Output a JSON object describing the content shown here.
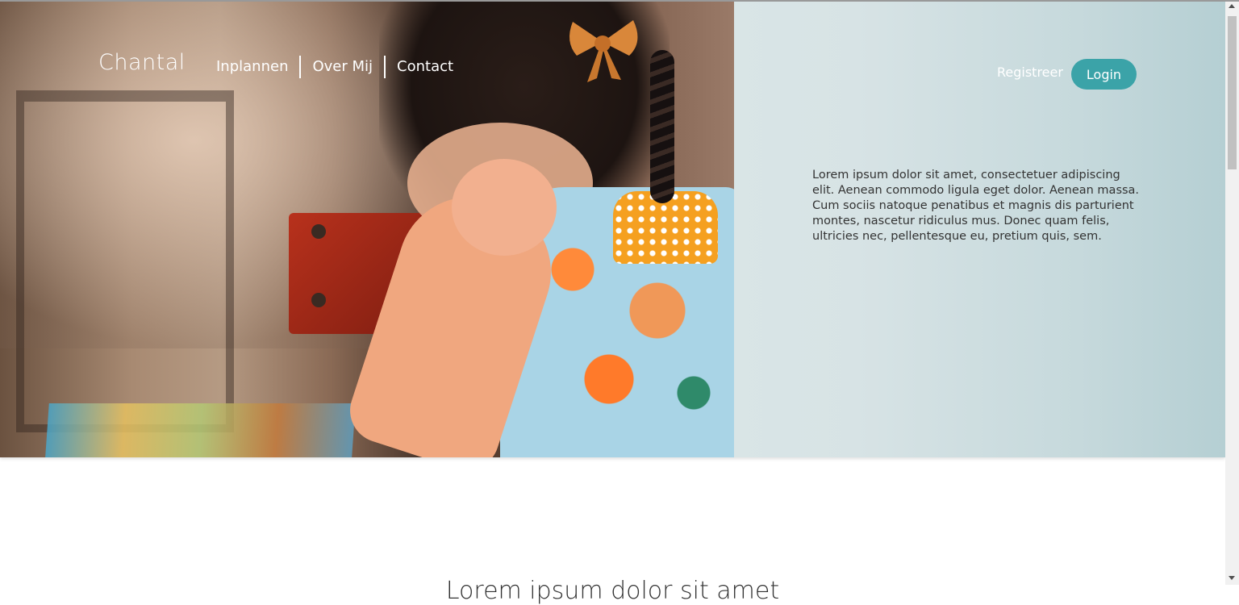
{
  "header": {
    "brand": "Chantal",
    "nav": [
      {
        "label": "Inplannen"
      },
      {
        "label": "Over Mij"
      },
      {
        "label": "Contact"
      }
    ],
    "register_label": "Registreer",
    "login_label": "Login"
  },
  "hero": {
    "image_alt": "child-reading-photo",
    "intro_text": "Lorem ipsum dolor sit amet, consectetuer adipiscing elit. Aenean commodo ligula eget dolor. Aenean massa. Cum sociis natoque penatibus et magnis dis parturient montes, nascetur ridiculus mus. Donec quam felis, ultricies nec, pellentesque eu, pretium quis, sem."
  },
  "main": {
    "section_title": "Lorem ipsum dolor sit amet"
  },
  "colors": {
    "accent": "#3ba3a8",
    "panel": "#d4e2e4",
    "text": "#333333"
  }
}
